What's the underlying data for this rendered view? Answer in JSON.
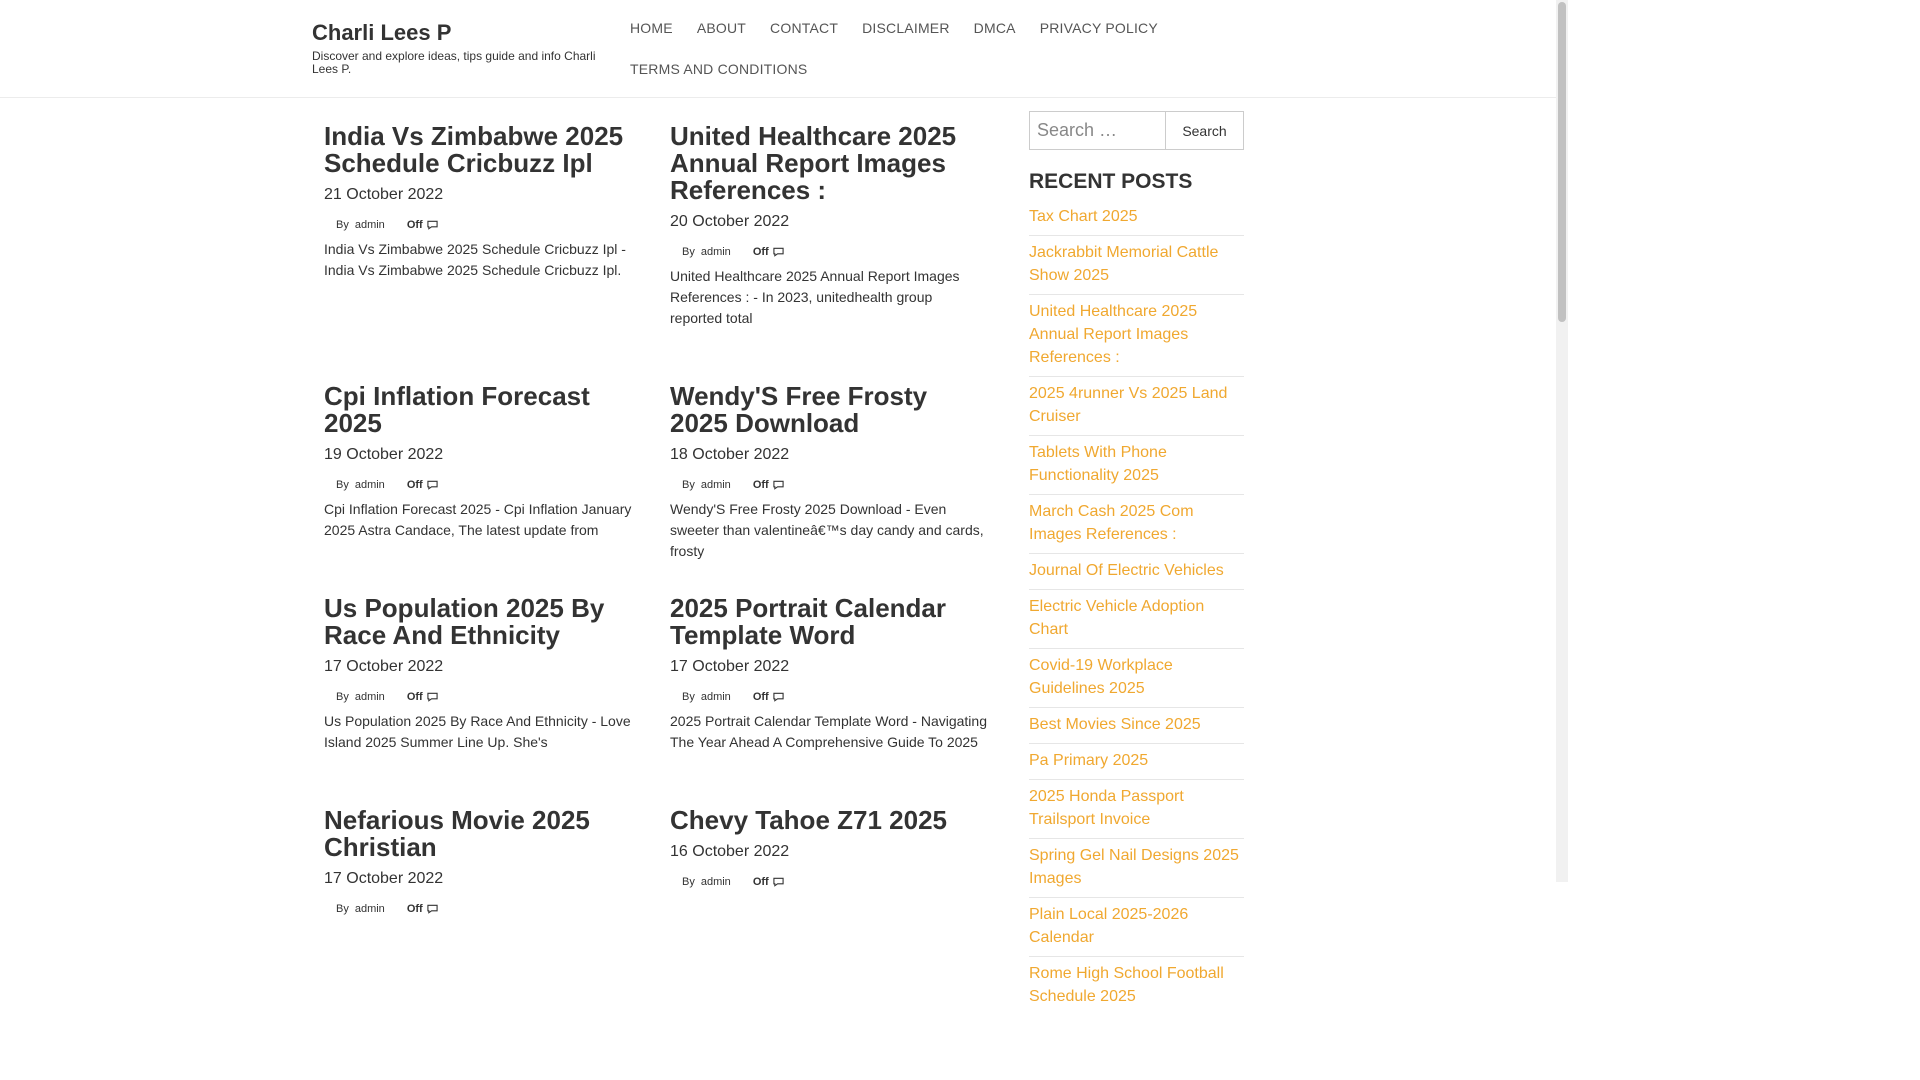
{
  "header": {
    "title": "Charli Lees P",
    "description": "Discover and explore ideas, tips guide and info Charli Lees P."
  },
  "nav": [
    "HOME",
    "ABOUT",
    "CONTACT",
    "DISCLAIMER",
    "DMCA",
    "PRIVACY POLICY",
    "TERMS AND CONDITIONS"
  ],
  "posts": [
    {
      "title": "India Vs Zimbabwe 2025 Schedule Cricbuzz Ipl",
      "date": "21 October 2022",
      "by": "By",
      "author": "admin",
      "comments": "Off",
      "excerpt": "India Vs Zimbabwe 2025 Schedule Cricbuzz Ipl - India Vs Zimbabwe 2025 Schedule Cricbuzz Ipl."
    },
    {
      "title": "United Healthcare 2025 Annual Report Images References :",
      "date": "20 October 2022",
      "by": "By",
      "author": "admin",
      "comments": "Off",
      "excerpt": "United Healthcare 2025 Annual Report Images References : - In 2023, unitedhealth group reported total"
    },
    {
      "title": "Cpi Inflation Forecast 2025",
      "date": "19 October 2022",
      "by": "By",
      "author": "admin",
      "comments": "Off",
      "excerpt": "Cpi Inflation Forecast 2025 - Cpi Inflation January 2025 Astra Candace, The latest update from"
    },
    {
      "title": "Wendy'S Free Frosty 2025 Download",
      "date": "18 October 2022",
      "by": "By",
      "author": "admin",
      "comments": "Off",
      "excerpt": "Wendy'S Free Frosty 2025 Download - Even sweeter than valentineâ€™s day candy and cards, frosty"
    },
    {
      "title": "Us Population 2025 By Race And Ethnicity",
      "date": "17 October 2022",
      "by": "By",
      "author": "admin",
      "comments": "Off",
      "excerpt": "Us Population 2025 By Race And Ethnicity - Love Island 2025 Summer Line Up. She's"
    },
    {
      "title": "2025 Portrait Calendar Template Word",
      "date": "17 October 2022",
      "by": "By",
      "author": "admin",
      "comments": "Off",
      "excerpt": "2025 Portrait Calendar Template Word - Navigating The Year Ahead A Comprehensive Guide To 2025"
    },
    {
      "title": "Nefarious Movie 2025 Christian",
      "date": "17 October 2022",
      "by": "By",
      "author": "admin",
      "comments": "Off",
      "excerpt": ""
    },
    {
      "title": "Chevy Tahoe Z71 2025",
      "date": "16 October 2022",
      "by": "By",
      "author": "admin",
      "comments": "Off",
      "excerpt": ""
    }
  ],
  "sidebar": {
    "search_placeholder": "Search …",
    "search_button": "Search",
    "recent_title": "RECENT POSTS",
    "recent_posts": [
      "Tax Chart 2025",
      "Jackrabbit Memorial Cattle Show 2025",
      "United Healthcare 2025 Annual Report Images References :",
      "2025 4runner Vs 2025 Land Cruiser",
      "Tablets With Phone Functionality 2025",
      "March Cash 2025 Com Images References :",
      "Journal Of Electric Vehicles",
      "Electric Vehicle Adoption Chart",
      "Covid-19 Workplace Guidelines 2025",
      "Best Movies Since 2025",
      "Pa Primary 2025",
      "2025 Honda Passport Trailsport Invoice",
      "Spring Gel Nail Designs 2025 Images",
      "Plain Local 2025-2026 Calendar",
      "Rome High School Football Schedule 2025"
    ]
  },
  "colors": {
    "accent": "#f0a830",
    "text": "#333333"
  }
}
